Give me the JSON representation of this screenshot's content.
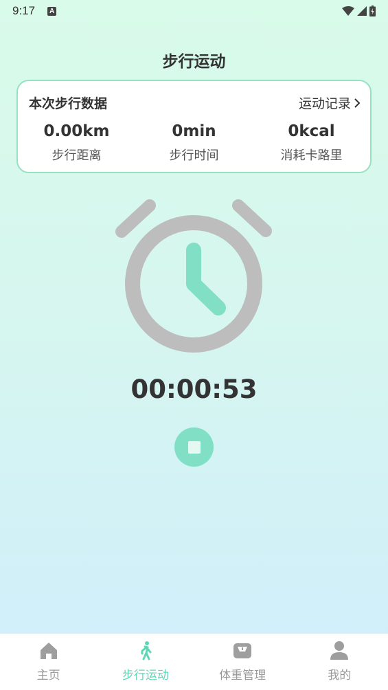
{
  "status_bar": {
    "time": "9:17",
    "notification_badge": "A"
  },
  "header": {
    "title": "步行运动"
  },
  "card": {
    "title": "本次步行数据",
    "history_link": "运动记录",
    "stats": [
      {
        "value": "0.00km",
        "label": "步行距离"
      },
      {
        "value": "0min",
        "label": "步行时间"
      },
      {
        "value": "0kcal",
        "label": "消耗卡路里"
      }
    ]
  },
  "timer": {
    "elapsed": "00:00:53"
  },
  "colors": {
    "accent": "#5fd6b6",
    "clock_body": "#bdbdbd",
    "border": "#94e2c2"
  },
  "tabbar": {
    "tabs": [
      {
        "label": "主页",
        "icon": "home-icon",
        "active": false
      },
      {
        "label": "步行运动",
        "icon": "walking-icon",
        "active": true
      },
      {
        "label": "体重管理",
        "icon": "scale-icon",
        "active": false
      },
      {
        "label": "我的",
        "icon": "person-icon",
        "active": false
      }
    ]
  }
}
